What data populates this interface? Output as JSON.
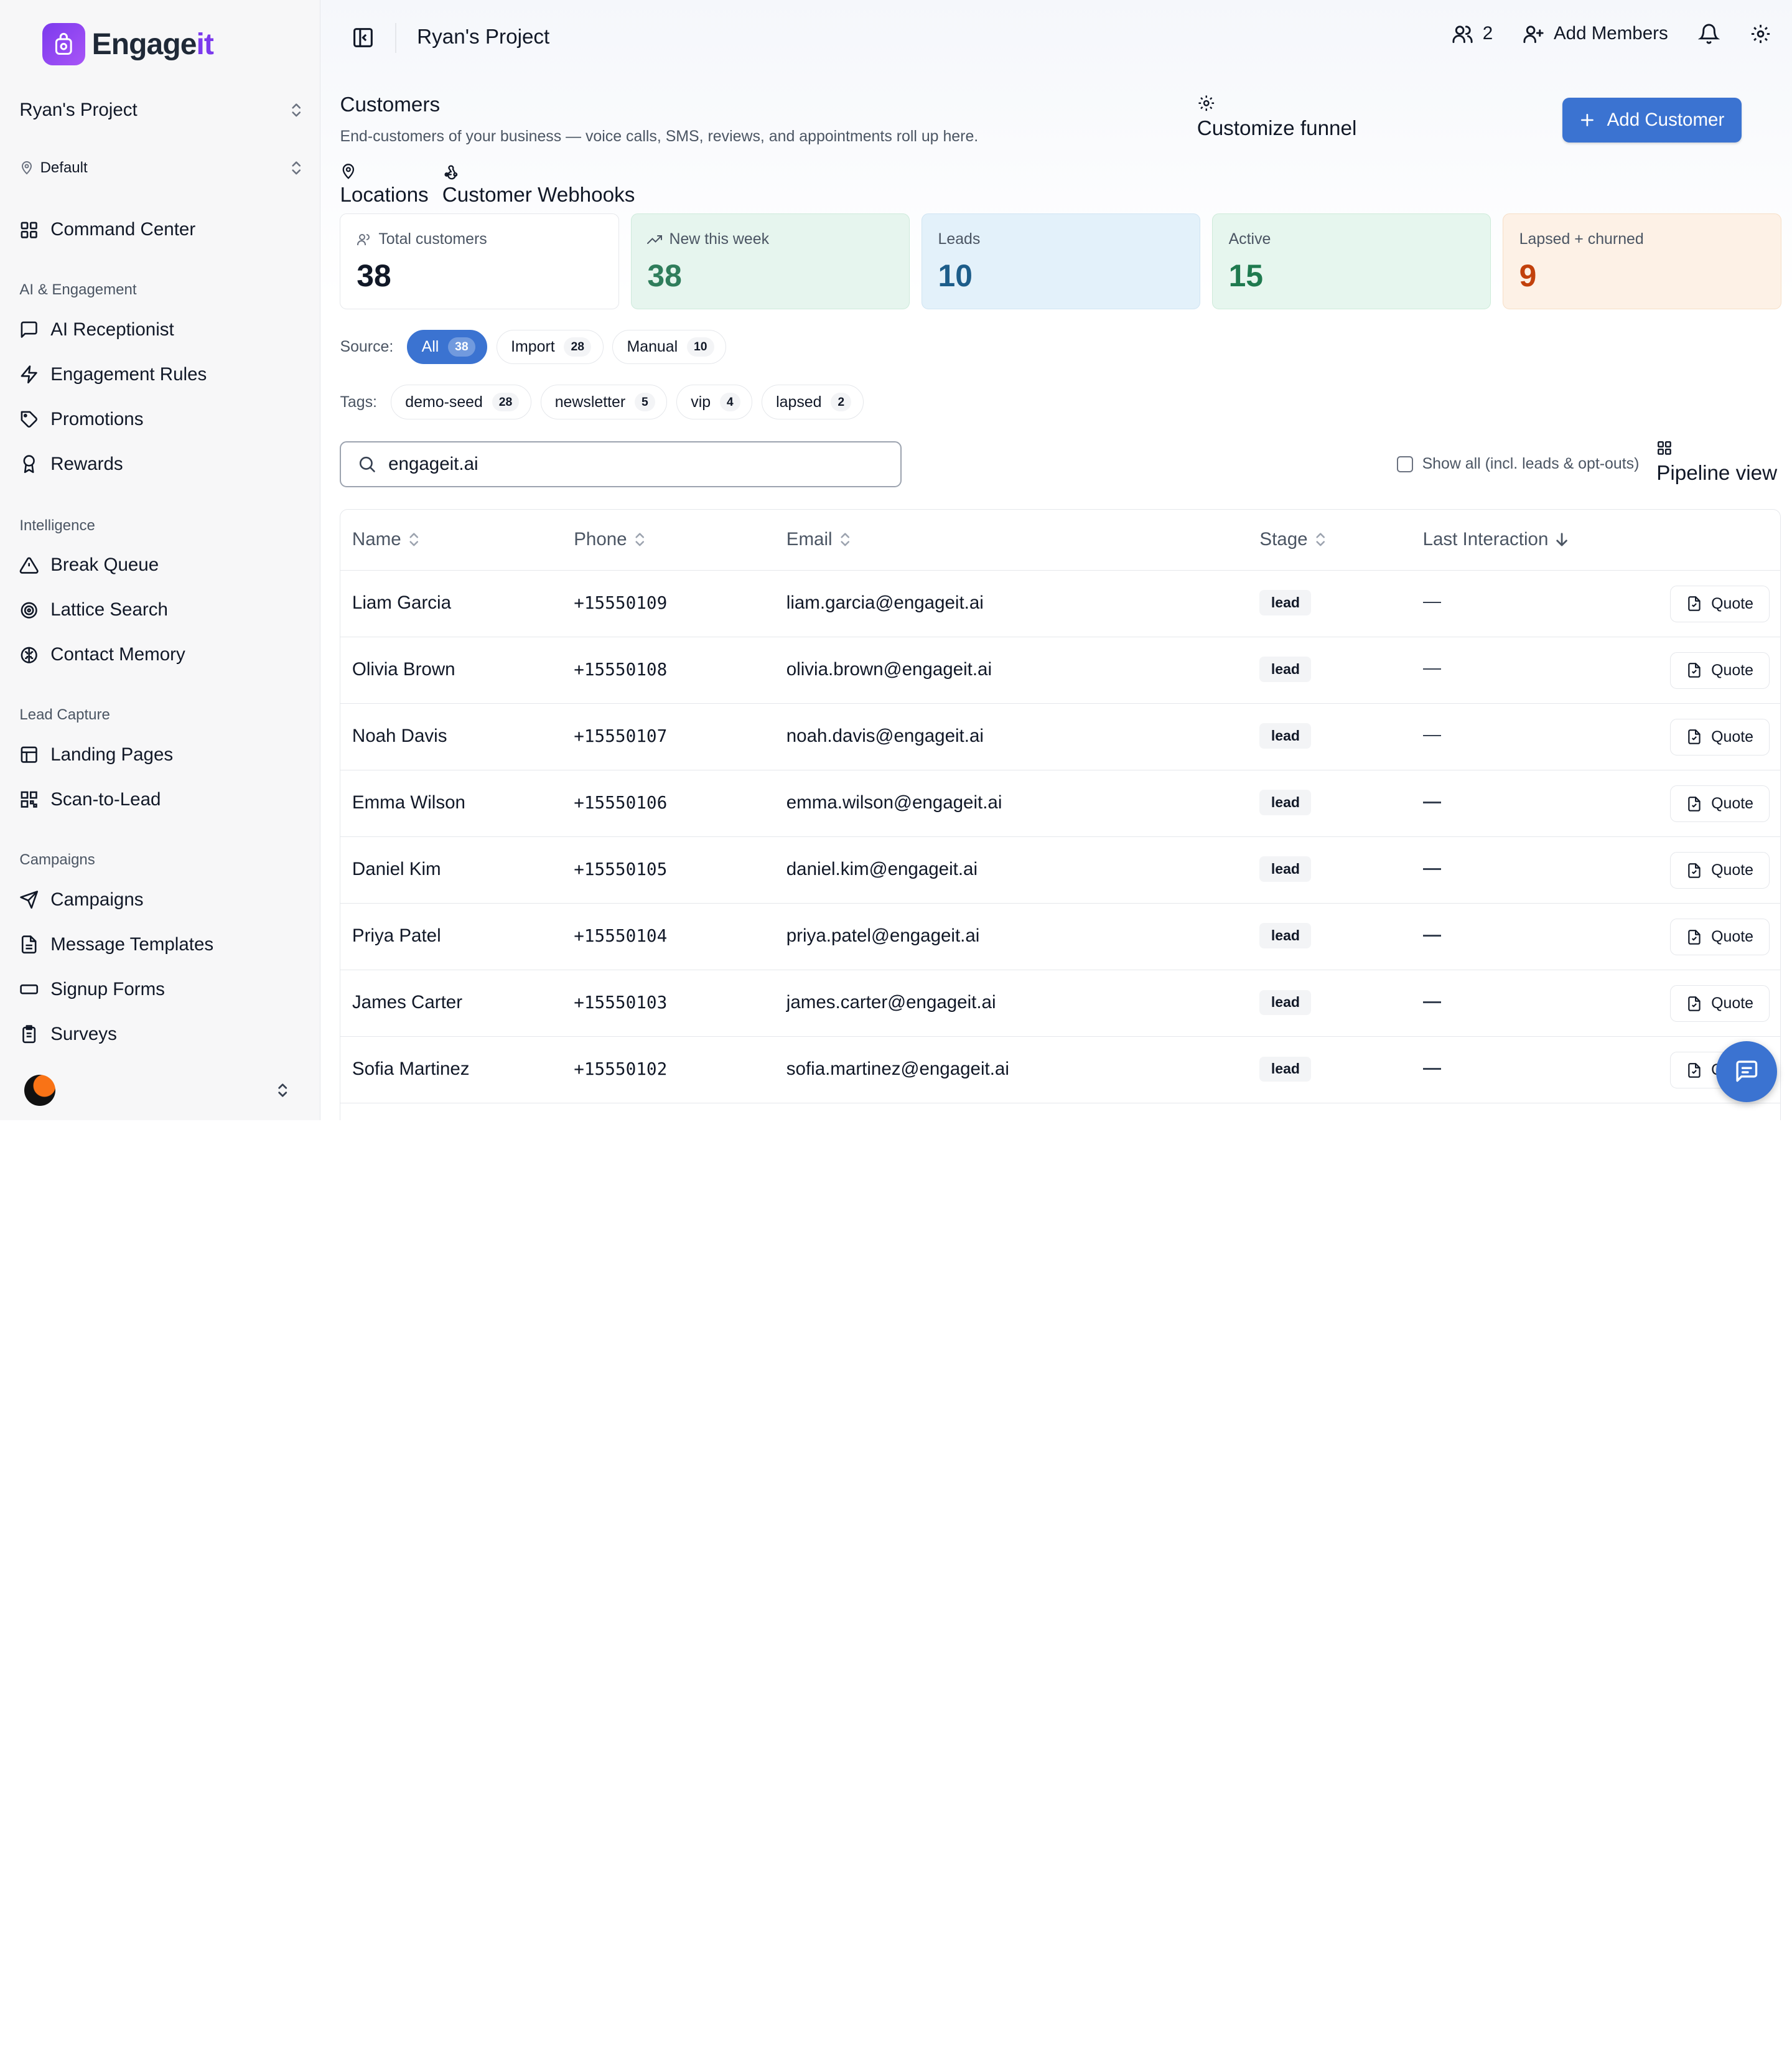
{
  "sidebar": {
    "logo": {
      "part1": "Engage",
      "part2": "it"
    },
    "project": "Ryan's Project",
    "location": "Default",
    "command_center": "Command Center",
    "sections": [
      {
        "title": "AI & Engagement",
        "items": [
          "AI Receptionist",
          "Engagement Rules",
          "Promotions",
          "Rewards"
        ]
      },
      {
        "title": "Intelligence",
        "items": [
          "Break Queue",
          "Lattice Search",
          "Contact Memory"
        ]
      },
      {
        "title": "Lead Capture",
        "items": [
          "Landing Pages",
          "Scan-to-Lead"
        ]
      },
      {
        "title": "Campaigns",
        "items": [
          "Campaigns",
          "Message Templates",
          "Signup Forms",
          "Surveys"
        ]
      }
    ]
  },
  "topbar": {
    "title": "Ryan's Project",
    "members_count": "2",
    "add_members": "Add Members"
  },
  "page": {
    "title": "Customers",
    "subtitle": "End-customers of your business — voice calls, SMS, reviews, and appointments roll up here.",
    "customize_funnel": "Customize funnel",
    "add_customer": "Add Customer",
    "locations_link": "Locations",
    "webhooks_link": "Customer Webhooks"
  },
  "stats": [
    {
      "label": "Total customers",
      "value": "38",
      "color": "#111827",
      "bg": "#ffffff",
      "border": "#e5e7eb"
    },
    {
      "label": "New this week",
      "value": "38",
      "color": "#2f7d5b",
      "bg": "#e6f5ee",
      "border": "#cdeadb"
    },
    {
      "label": "Leads",
      "value": "10",
      "color": "#1d5d8a",
      "bg": "#e3f1fa",
      "border": "#cfe4f2"
    },
    {
      "label": "Active",
      "value": "15",
      "color": "#1f7a4f",
      "bg": "#e6f6ee",
      "border": "#cdebd9"
    },
    {
      "label": "Lapsed + churned",
      "value": "9",
      "color": "#c2410c",
      "bg": "#fdf1e6",
      "border": "#f6dec6"
    }
  ],
  "source": {
    "label": "Source:",
    "chips": [
      {
        "label": "All",
        "count": "38",
        "active": true
      },
      {
        "label": "Import",
        "count": "28",
        "active": false
      },
      {
        "label": "Manual",
        "count": "10",
        "active": false
      }
    ]
  },
  "tags": {
    "label": "Tags:",
    "chips": [
      {
        "label": "demo-seed",
        "count": "28"
      },
      {
        "label": "newsletter",
        "count": "5"
      },
      {
        "label": "vip",
        "count": "4"
      },
      {
        "label": "lapsed",
        "count": "2"
      }
    ]
  },
  "search": {
    "value": "engageit.ai"
  },
  "show_all_label": "Show all (incl. leads & opt-outs)",
  "pipeline_view": "Pipeline view",
  "table": {
    "columns": [
      "Name",
      "Phone",
      "Email",
      "Stage",
      "Last Interaction"
    ],
    "quote_label": "Quote",
    "rows": [
      {
        "name": "Liam Garcia",
        "phone": "+15550109",
        "email": "liam.garcia@engageit.ai",
        "stage": "lead"
      },
      {
        "name": "Olivia Brown",
        "phone": "+15550108",
        "email": "olivia.brown@engageit.ai",
        "stage": "lead"
      },
      {
        "name": "Noah Davis",
        "phone": "+15550107",
        "email": "noah.davis@engageit.ai",
        "stage": "lead"
      },
      {
        "name": "Emma Wilson",
        "phone": "+15550106",
        "email": "emma.wilson@engageit.ai",
        "stage": "lead"
      },
      {
        "name": "Daniel Kim",
        "phone": "+15550105",
        "email": "daniel.kim@engageit.ai",
        "stage": "lead"
      },
      {
        "name": "Priya Patel",
        "phone": "+15550104",
        "email": "priya.patel@engageit.ai",
        "stage": "lead"
      },
      {
        "name": "James Carter",
        "phone": "+15550103",
        "email": "james.carter@engageit.ai",
        "stage": "lead"
      },
      {
        "name": "Sofia Martinez",
        "phone": "+15550102",
        "email": "sofia.martinez@engageit.ai",
        "stage": "lead"
      }
    ]
  },
  "colors": {
    "accent": "#3b73d1",
    "brand": "#7c3aed"
  }
}
